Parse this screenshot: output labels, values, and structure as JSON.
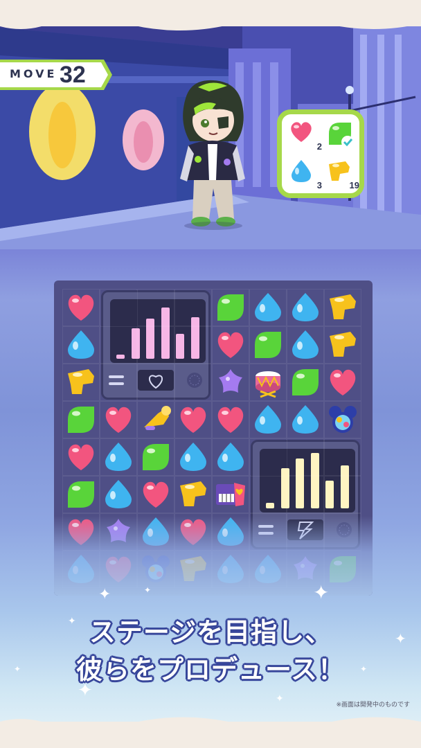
{
  "hud": {
    "move_label": "MOVE",
    "move_count": "32"
  },
  "goals": [
    {
      "kind": "pink-heart-candy",
      "count": "2",
      "done": false
    },
    {
      "kind": "green-leaf-candy",
      "count": "",
      "done": true,
      "status_icon": "check-icon"
    },
    {
      "kind": "blue-drop-candy",
      "count": "3",
      "done": false
    },
    {
      "kind": "yellow-block-candy",
      "count": "19",
      "done": false
    }
  ],
  "board": {
    "columns": 8,
    "rows": 8,
    "tiles": [
      [
        "pink",
        "speaker-a",
        "speaker-a",
        "speaker-a",
        "green",
        "blue",
        "blue",
        "yellow"
      ],
      [
        "blue",
        "speaker-a",
        "speaker-a",
        "speaker-a",
        "pink",
        "green",
        "blue",
        "yellow"
      ],
      [
        "yellow",
        "speaker-a",
        "speaker-a",
        "speaker-a",
        "purple-star",
        "drum",
        "green",
        "pink"
      ],
      [
        "green",
        "pink",
        "trumpet",
        "pink",
        "pink",
        "blue",
        "blue",
        "mickey-badge"
      ],
      [
        "pink",
        "blue",
        "green",
        "blue",
        "blue",
        "speaker-b",
        "speaker-b",
        "speaker-b"
      ],
      [
        "green",
        "blue",
        "pink",
        "yellow",
        "keyboard",
        "speaker-b",
        "speaker-b",
        "speaker-b"
      ],
      [
        "pink",
        "purple-star",
        "blue",
        "pink",
        "blue",
        "speaker-b",
        "speaker-b",
        "speaker-b"
      ],
      [
        "blue",
        "pink",
        "mickey-badge",
        "yellow",
        "blue",
        "blue",
        "purple-star",
        "green"
      ]
    ],
    "speaker_a": {
      "icon": "heart-icon",
      "levels": [
        0.08,
        0.55,
        0.72,
        0.92,
        0.45,
        0.75
      ]
    },
    "speaker_b": {
      "icon": "lightning-icon",
      "levels": [
        0.1,
        0.72,
        0.9,
        1.0,
        0.5,
        0.78
      ]
    }
  },
  "colors": {
    "pink": "#f2557f",
    "blue": "#3fb4f0",
    "green": "#59d43a",
    "yellow": "#f7c21c",
    "purple": "#a47bf0",
    "goal_border": "#a6d84a",
    "text_dark": "#2d3350"
  },
  "caption": {
    "line1": "ステージを目指し、",
    "line2": "彼らをプロデュース！"
  },
  "note": "※画面は開発中のものです"
}
